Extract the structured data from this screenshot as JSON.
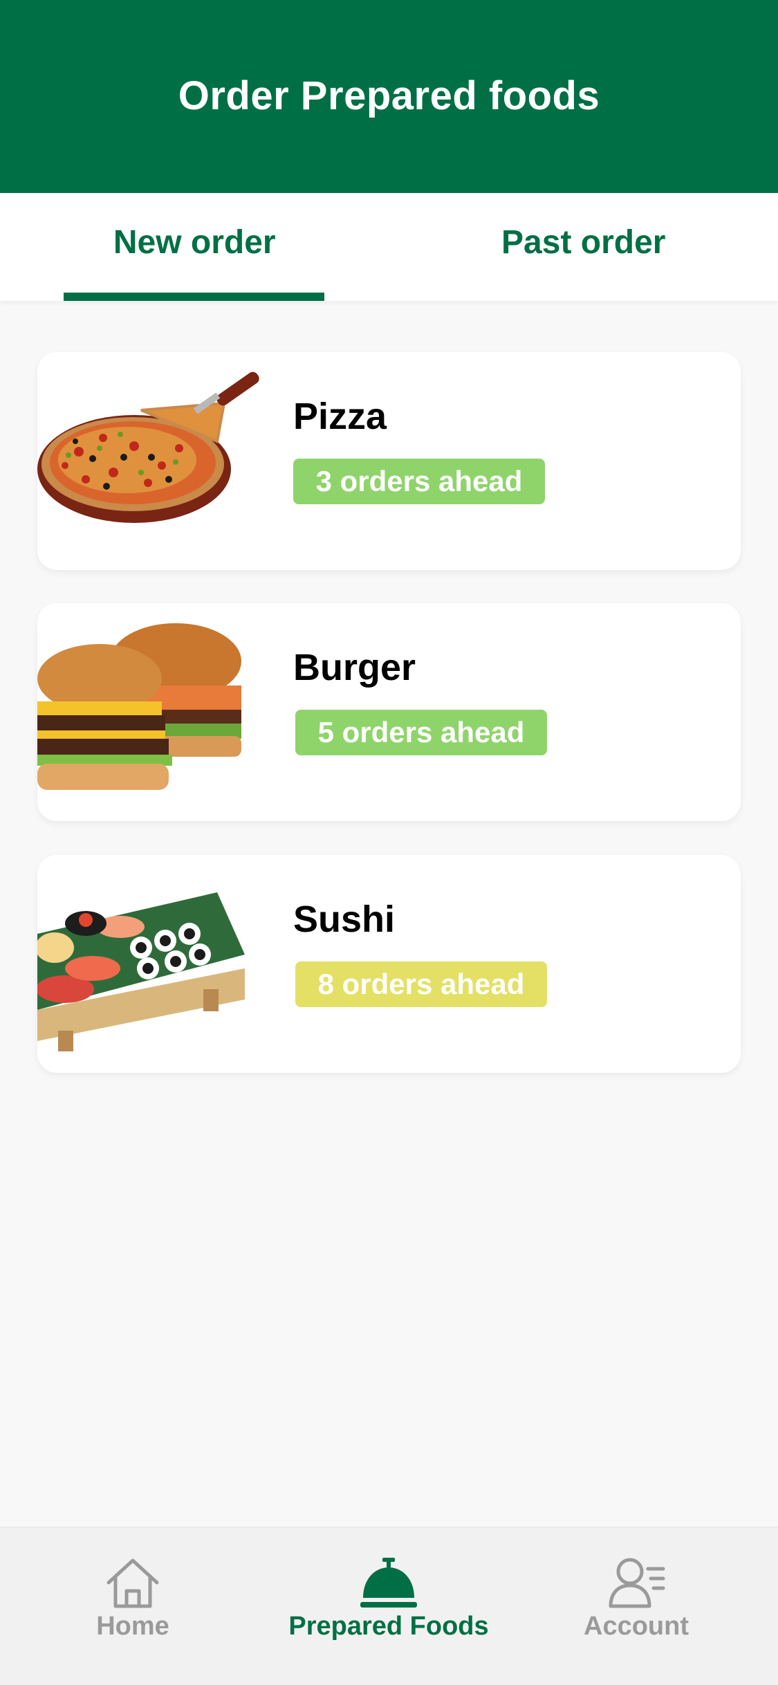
{
  "header": {
    "title": "Order Prepared foods"
  },
  "tabs": [
    {
      "label": "New order",
      "active": true
    },
    {
      "label": "Past order",
      "active": false
    }
  ],
  "foods": [
    {
      "name": "Pizza",
      "status": "3 orders ahead",
      "badge_color": "#8fd46b",
      "image": "pizza-image"
    },
    {
      "name": "Burger",
      "status": "5 orders ahead",
      "badge_color": "#8fd46b",
      "image": "burger-image"
    },
    {
      "name": "Sushi",
      "status": "8 orders ahead",
      "badge_color": "#e4e065",
      "image": "sushi-image"
    }
  ],
  "bottom_nav": [
    {
      "label": "Home",
      "icon": "home-icon",
      "active": false
    },
    {
      "label": "Prepared Foods",
      "icon": "cloche-icon",
      "active": true
    },
    {
      "label": "Account",
      "icon": "account-icon",
      "active": false
    }
  ],
  "colors": {
    "brand": "#006f45",
    "background": "#f8f8f8",
    "inactive": "#9a9a9a"
  }
}
